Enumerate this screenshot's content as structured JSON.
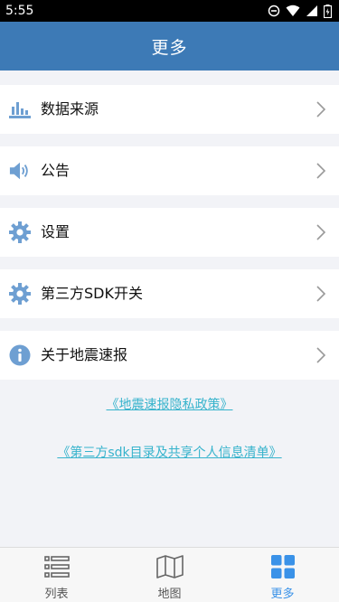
{
  "status_bar": {
    "time": "5:55"
  },
  "header": {
    "title": "更多"
  },
  "menu": [
    {
      "label": "数据来源",
      "icon": "bar-chart-icon"
    },
    {
      "label": "公告",
      "icon": "speaker-icon"
    },
    {
      "label": "设置",
      "icon": "gear-icon"
    },
    {
      "label": "第三方SDK开关",
      "icon": "gear-icon"
    },
    {
      "label": "关于地震速报",
      "icon": "info-icon"
    }
  ],
  "links": {
    "privacy_policy": "《地震速报隐私政策》",
    "third_party_list": "《第三方sdk目录及共享个人信息清单》"
  },
  "bottom_nav": [
    {
      "label": "列表",
      "icon": "list-icon"
    },
    {
      "label": "地图",
      "icon": "map-icon"
    },
    {
      "label": "更多",
      "icon": "grid-icon",
      "active": true
    }
  ],
  "colors": {
    "header": "#3d7ab6",
    "icon": "#6e9fd2",
    "link": "#36b3cc",
    "nav_active": "#3a92e8"
  }
}
